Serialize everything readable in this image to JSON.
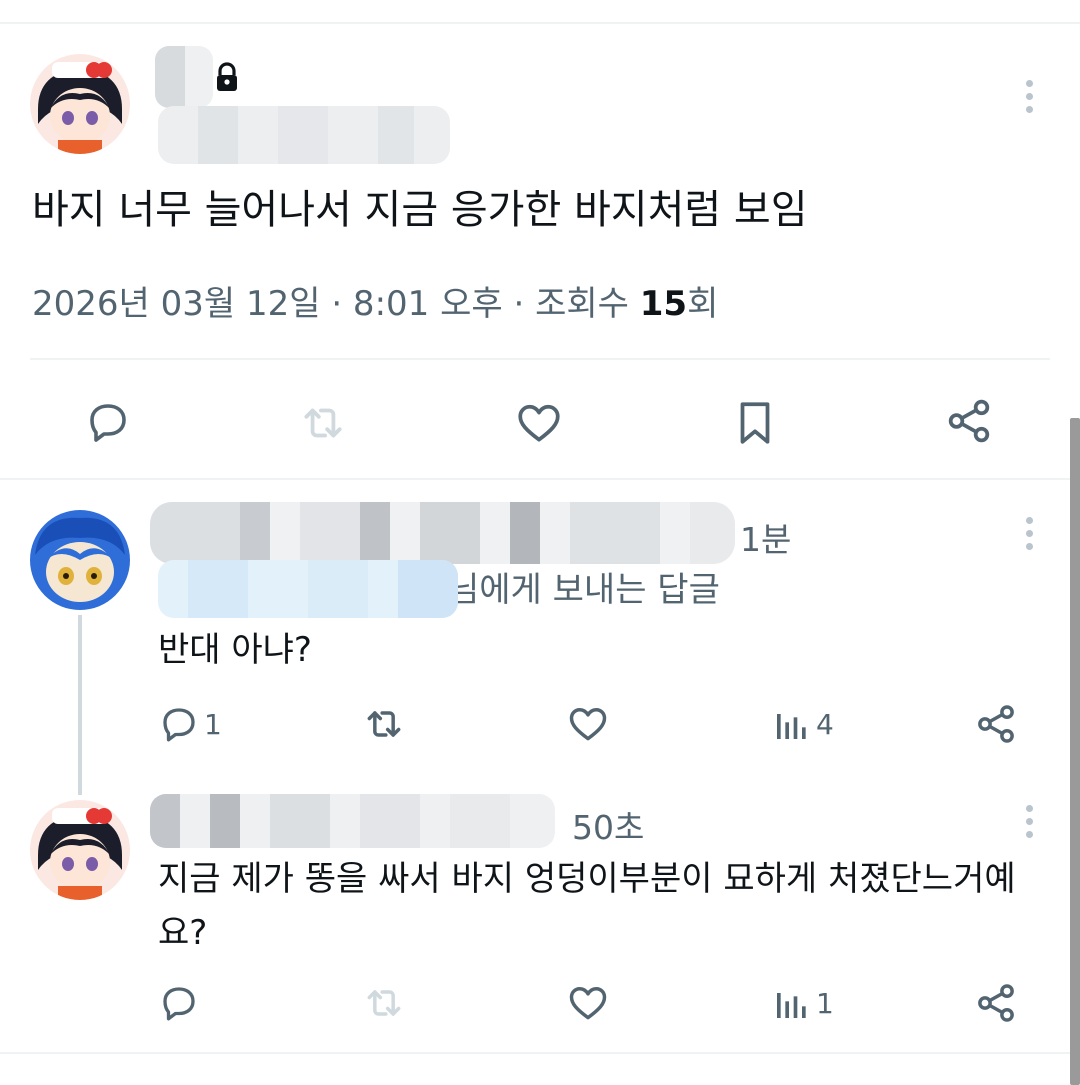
{
  "post": {
    "text": "바지 너무 늘어나서 지금 응가한 바지처럼 보임",
    "date": "2026년 03월 12일 · 8:01 오후 · 조회수 ",
    "views": "15",
    "views_suffix": "회"
  },
  "reply1": {
    "time": "1분",
    "reply_to_suffix": "님에게 보내는 답글",
    "text": "반대 아냐?",
    "reply_count": "1",
    "view_count": "4"
  },
  "reply2": {
    "time": "50초",
    "text": "지금 제가 똥을 싸서 바지 엉덩이부분이 묘하게 처졌단느거예요?",
    "view_count": "1"
  },
  "colors": {
    "text": "#0f1419",
    "secondary": "#536471",
    "divider": "#eff3f4",
    "icon": "#536471"
  }
}
